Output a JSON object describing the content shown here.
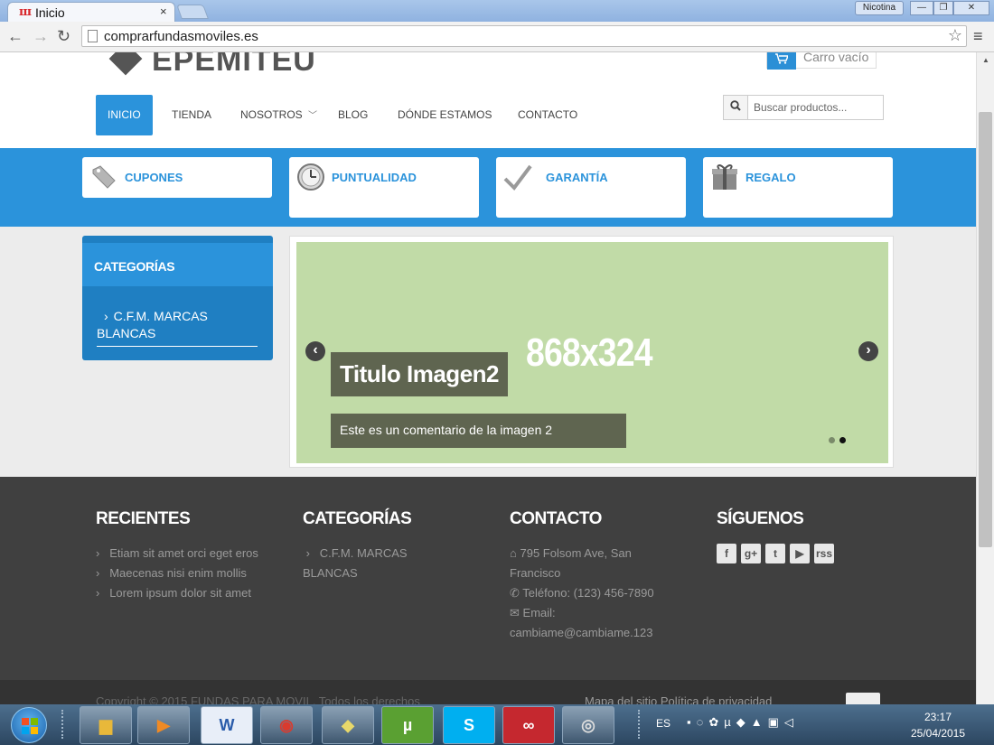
{
  "browser": {
    "tab_logo": "ш",
    "tab_title": "Inicio",
    "tab_close": "×",
    "user_badge": "Nicotina",
    "url": "comprarfundasmoviles.es"
  },
  "header": {
    "logo_text": "EPEMITEU",
    "cart_label": "Carro vacío",
    "nav": [
      {
        "label": "INICIO"
      },
      {
        "label": "TIENDA"
      },
      {
        "label": "NOSOTROS"
      },
      {
        "label": "BLOG"
      },
      {
        "label": "DÓNDE ESTAMOS"
      },
      {
        "label": "CONTACTO"
      }
    ],
    "search_placeholder": "Buscar productos..."
  },
  "features": [
    {
      "label": "CUPONES",
      "icon": "tag-icon"
    },
    {
      "label": "PUNTUALIDAD",
      "icon": "clock-icon"
    },
    {
      "label": "GARANTÍA",
      "icon": "checkmark-icon"
    },
    {
      "label": "REGALO",
      "icon": "gift-icon"
    }
  ],
  "sidebar": {
    "title": "CATEGORÍAS",
    "items": [
      {
        "label": "C.F.M. MARCAS BLANCAS"
      }
    ]
  },
  "slider": {
    "dimensions": "868x324",
    "title": "Titulo Imagen2",
    "caption": "Este es un comentario de la imagen 2",
    "prev": "‹",
    "next": "›",
    "active_slide": 2,
    "slide_count": 2
  },
  "footer": {
    "recientes": {
      "title": "RECIENTES",
      "items": [
        "Etiam sit amet orci eget eros",
        "Maecenas nisi enim mollis",
        "Lorem ipsum dolor sit amet"
      ]
    },
    "categorias": {
      "title": "CATEGORÍAS",
      "items": [
        "C.F.M. MARCAS BLANCAS"
      ]
    },
    "contacto": {
      "title": "CONTACTO",
      "address": "795 Folsom Ave, San Francisco",
      "phone": "Teléfono: (123) 456-7890",
      "email_label": "Email:",
      "email": "cambiame@cambiame.123"
    },
    "siguenos": {
      "title": "SÍGUENOS",
      "networks": [
        "f",
        "g+",
        "t",
        "▶",
        "rss"
      ]
    },
    "copyright": "Copyright © 2015 FUNDAS PARA MOVIL. Todos los derechos",
    "links": "Mapa del sitio   Política de privacidad"
  },
  "taskbar": {
    "apps": [
      "explorer",
      "media-player",
      "W",
      "chrome",
      "notes",
      "µ",
      "S",
      "creative-cloud",
      "camera"
    ],
    "lang": "ES",
    "time": "23:17",
    "date": "25/04/2015"
  }
}
